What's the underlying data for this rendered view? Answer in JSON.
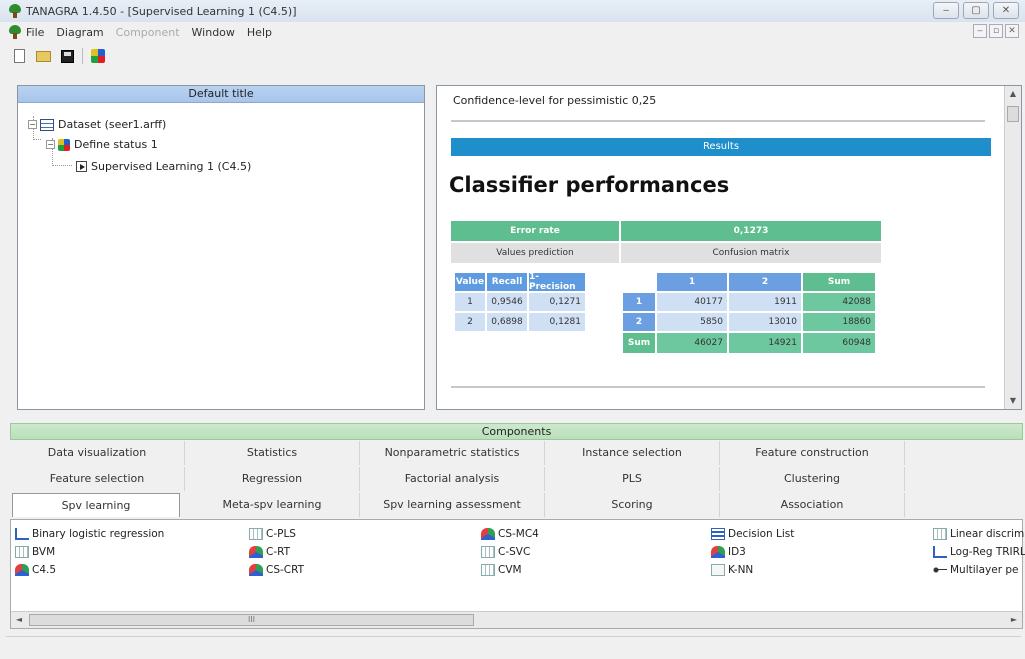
{
  "window": {
    "title": "TANAGRA 1.4.50 - [Supervised Learning 1 (C4.5)]",
    "controls": [
      "‒",
      "▢",
      "✕"
    ],
    "mdi_controls": [
      "‒",
      "▫",
      "✕"
    ]
  },
  "menu": {
    "items": [
      {
        "label": "File",
        "enabled": true
      },
      {
        "label": "Diagram",
        "enabled": true
      },
      {
        "label": "Component",
        "enabled": false
      },
      {
        "label": "Window",
        "enabled": true
      },
      {
        "label": "Help",
        "enabled": true
      }
    ]
  },
  "toolbar": {
    "icons": [
      "new-file-icon",
      "open-folder-icon",
      "save-disk-icon",
      "component-icon"
    ]
  },
  "tree": {
    "header": "Default title",
    "nodes": [
      {
        "label": "Dataset (seer1.arff)",
        "icon": "dataset-table-icon",
        "expander": "−"
      },
      {
        "label": "Define status 1",
        "icon": "define-status-icon",
        "expander": "−"
      },
      {
        "label": "Supervised Learning 1 (C4.5)",
        "icon": "supervised-learning-icon"
      }
    ]
  },
  "results": {
    "confidence_line": "Confidence-level for pessimistic  0,25",
    "section_label": "Results",
    "title": "Classifier performances",
    "error_rate_label": "Error rate",
    "error_rate_value": "0,1273",
    "values_prediction_label": "Values prediction",
    "confusion_matrix_label": "Confusion matrix",
    "vp_headers": [
      "Value",
      "Recall",
      "1-Precision"
    ],
    "vp_rows": [
      [
        "1",
        "0,9546",
        "0,1271"
      ],
      [
        "2",
        "0,6898",
        "0,1281"
      ]
    ],
    "cm_headers": [
      "1",
      "2",
      "Sum"
    ],
    "cm_rows": [
      {
        "label": "1",
        "values": [
          "40177",
          "1911",
          "42088"
        ]
      },
      {
        "label": "2",
        "values": [
          "5850",
          "13010",
          "18860"
        ]
      },
      {
        "label": "Sum",
        "values": [
          "46027",
          "14921",
          "60948"
        ]
      }
    ]
  },
  "components": {
    "title": "Components",
    "tabs_row1": [
      "Data visualization",
      "Statistics",
      "Nonparametric statistics",
      "Instance selection",
      "Feature construction"
    ],
    "tabs_row2": [
      "Feature selection",
      "Regression",
      "Factorial analysis",
      "PLS",
      "Clustering"
    ],
    "tabs_row3": [
      "Spv learning",
      "Meta-spv learning",
      "Spv learning assessment",
      "Scoring",
      "Association"
    ],
    "active_tab": "Spv learning",
    "items": [
      [
        "Binary logistic regression",
        "C-PLS",
        "CS-MC4",
        "Decision List",
        "Linear discrim"
      ],
      [
        "BVM",
        "C-RT",
        "C-SVC",
        "ID3",
        "Log-Reg TRIRL"
      ],
      [
        "C4.5",
        "CS-CRT",
        "CVM",
        "K-NN",
        "Multilayer pe"
      ]
    ],
    "scroll_grip": "III",
    "scroll_left": "◄",
    "scroll_right": "►"
  },
  "scroll": {
    "up": "▲",
    "down": "▼"
  }
}
